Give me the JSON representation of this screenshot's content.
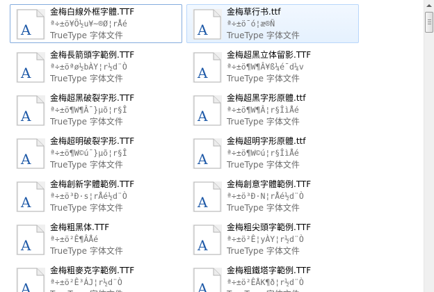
{
  "file_type_label": "TrueType 字体文件",
  "icon": "truetype-font-file-icon",
  "files": [
    {
      "name": "金梅白線外框字體.TTF",
      "sample": "ª÷±ö¥Õ½u¥~®Ø¦rÅé"
    },
    {
      "name": "金梅草行书.ttf",
      "sample": "ª÷±ö¯ó¦æ®Ñ"
    },
    {
      "name": "金梅長箭頭字範例.TTF",
      "sample": "ª÷±öªø½bÀY¦r½d¨Ò"
    },
    {
      "name": "金梅超黑立体留影.TTF",
      "sample": "ª÷±ö¶W¶Â¥ß¼é¯d¼v"
    },
    {
      "name": "金梅超黑破裂字形.TTF",
      "sample": "ª÷±ö¶W¶Â¯}µõ¦r§Î"
    },
    {
      "name": "金梅超黑字形原體.ttf",
      "sample": "ª÷±ö¶W¶Â¦r§Î­ìÅé"
    },
    {
      "name": "金梅超明破裂字形.TTF",
      "sample": "ª÷±ö¶W©ú¯}µõ¦r§Î"
    },
    {
      "name": "金梅超明字形原體.ttf",
      "sample": "ª÷±ö¶W©ú¦r§Î­ìÅé"
    },
    {
      "name": "金梅創新字體範例.TTF",
      "sample": "ª÷±ö³Ð·s¦rÅé½d¨Ò"
    },
    {
      "name": "金梅創意字體範例.TTF",
      "sample": "ª÷±ö³Ð·N¦rÅé½d¨Ò"
    },
    {
      "name": "金梅粗黑体.TTF",
      "sample": "ª÷±ö²Ê¶ÂÅé"
    },
    {
      "name": "金梅粗尖頭字範例.TTF",
      "sample": "ª÷±ö²Ê¦yÀY¦r½d¨Ò"
    },
    {
      "name": "金梅粗麥克字範例.TTF",
      "sample": "ª÷±ö²Ê³ÁJ¦r½d¨Ò"
    },
    {
      "name": "金梅粗鐵塔字範例.TTF",
      "sample": "ª÷±ö²ÊÅK¶ð¦r½d¨Ò"
    }
  ]
}
